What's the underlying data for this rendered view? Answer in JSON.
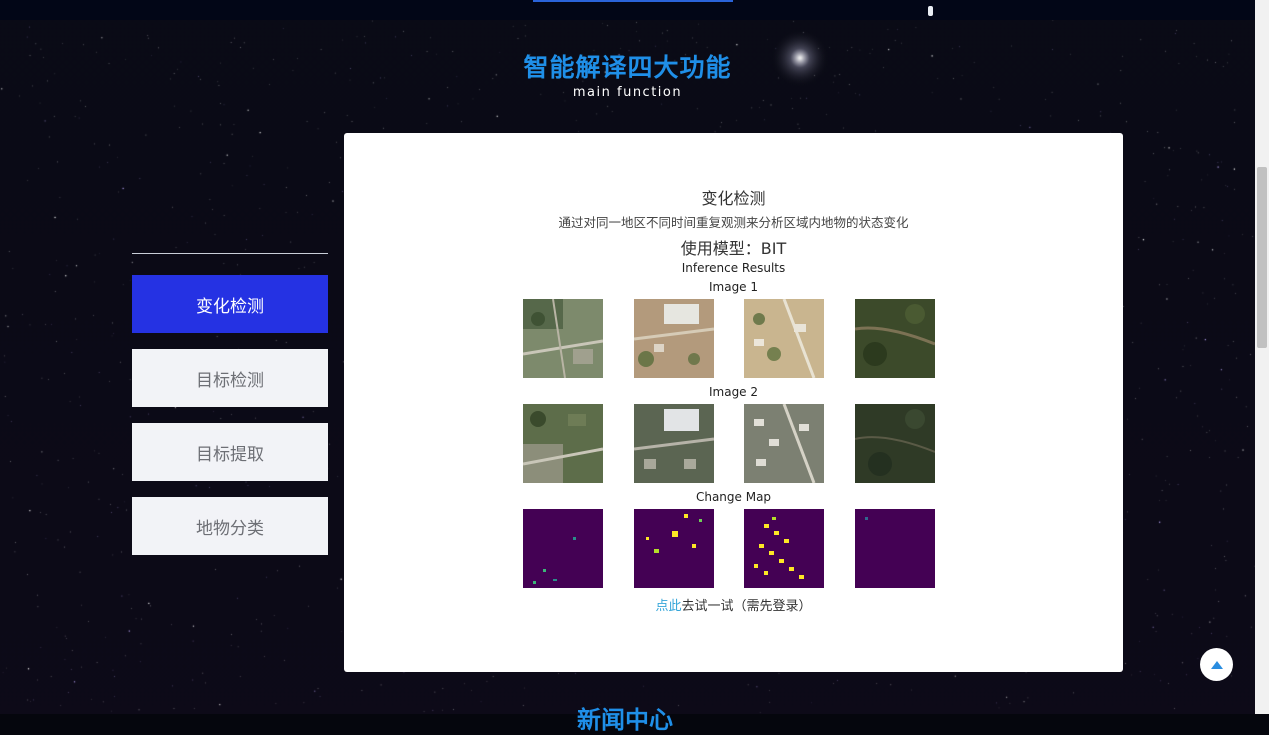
{
  "section": {
    "title": "智能解译四大功能",
    "subtitle": "main function"
  },
  "menu": {
    "items": [
      {
        "label": "变化检测",
        "active": true
      },
      {
        "label": "目标检测",
        "active": false
      },
      {
        "label": "目标提取",
        "active": false
      },
      {
        "label": "地物分类",
        "active": false
      }
    ]
  },
  "panel": {
    "title": "变化检测",
    "description": "通过对同一地区不同时间重复观测来分析区域内地物的状态变化",
    "model": "使用模型：BIT",
    "figure": {
      "heading": "Inference Results",
      "row1_label": "Image 1",
      "row2_label": "Image 2",
      "row3_label": "Change Map"
    },
    "cta": {
      "link": "点此",
      "text": "去试一试（需先登录）"
    }
  },
  "bottom_title": "新闻中心",
  "icons": {
    "back_to_top": "arrow-up-icon"
  },
  "colors": {
    "accent_blue": "#1f8fe8",
    "active_menu": "#2532e3",
    "link": "#36a6d9",
    "change_map_bg": "#440154",
    "change_map_fg": "#fde725"
  }
}
